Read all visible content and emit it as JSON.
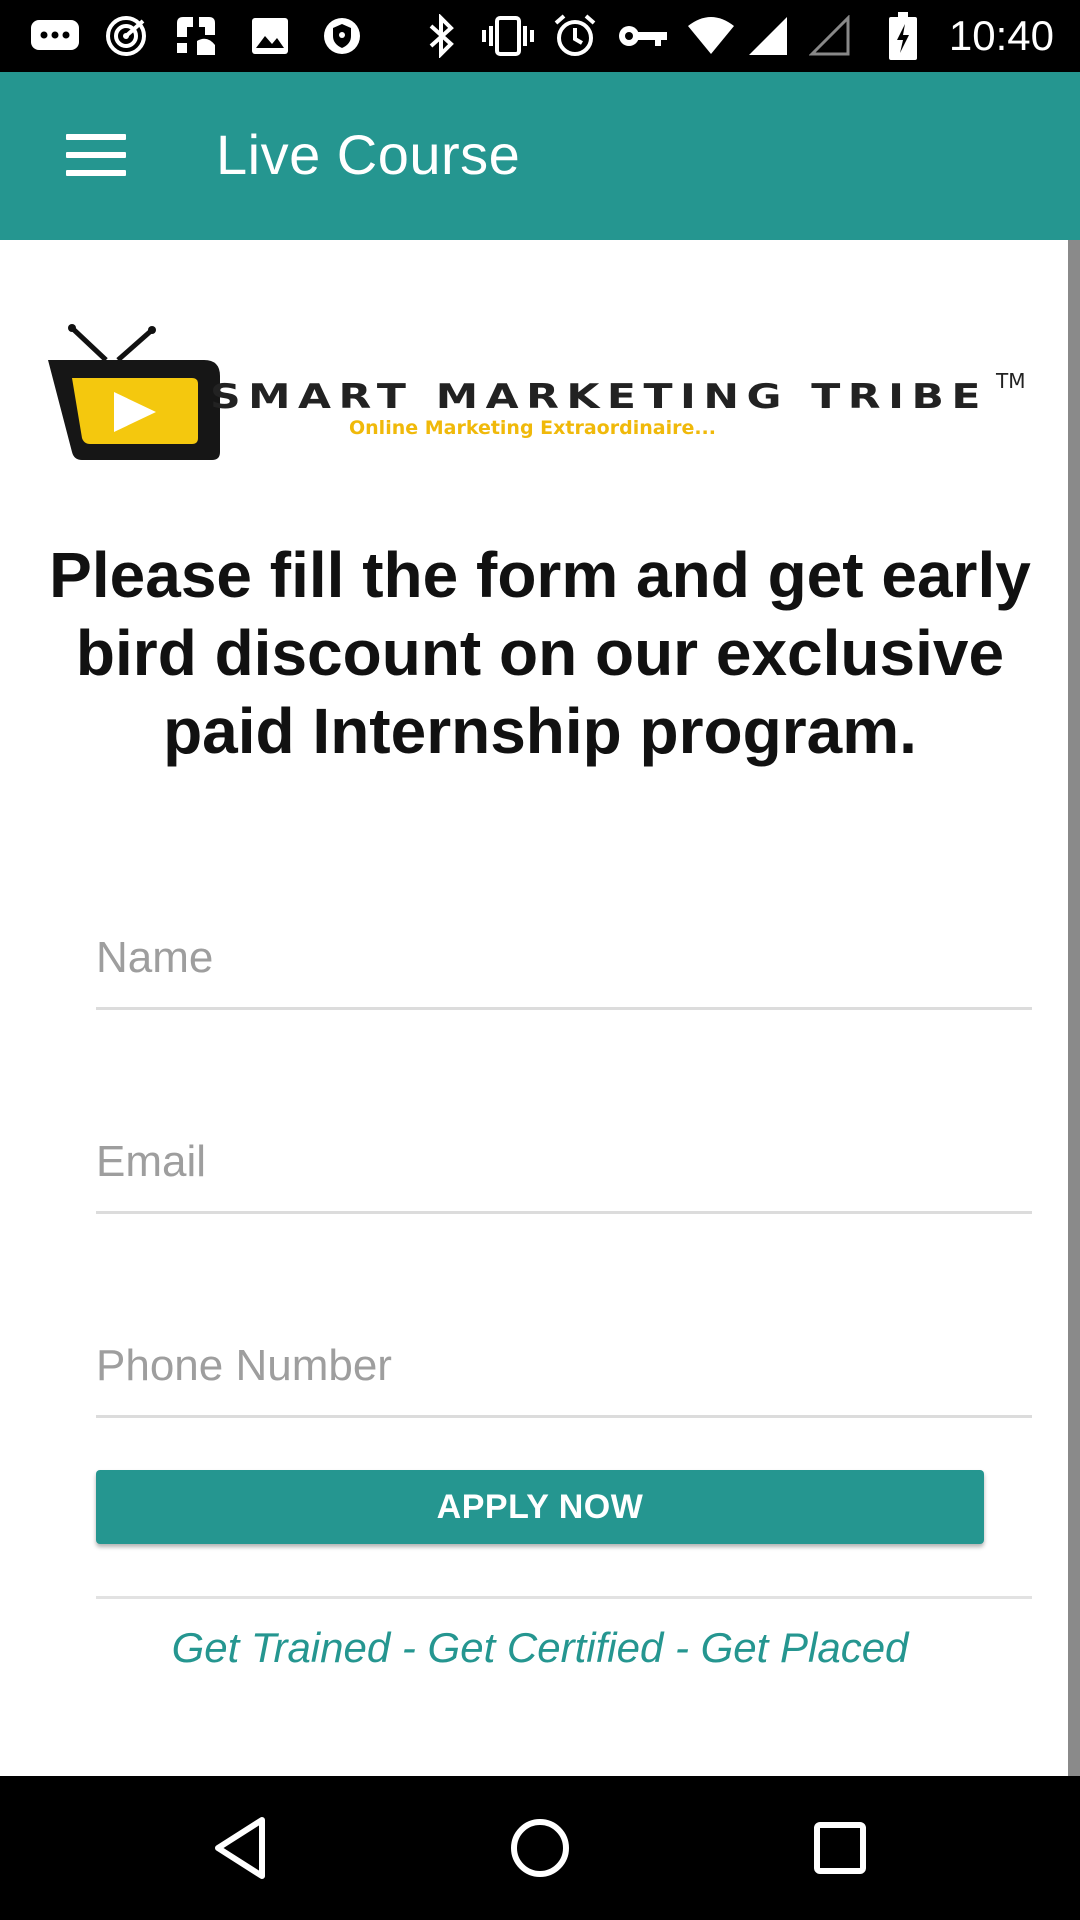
{
  "status_bar": {
    "time": "10:40",
    "icons": [
      "message-icon",
      "radar-icon",
      "app-icon",
      "image-icon",
      "shield-icon",
      "bluetooth-icon",
      "vibrate-icon",
      "alarm-icon",
      "vpn-key-icon",
      "wifi-icon",
      "signal-icon",
      "signal-empty-icon",
      "battery-charging-icon"
    ]
  },
  "app_bar": {
    "title": "Live Course",
    "background": "#259690"
  },
  "logo": {
    "brand": "SMART MARKETING TRIBE",
    "trademark": "TM",
    "slogan": "Online Marketing Extraordinaire..."
  },
  "headline": "Please fill the form and get early bird discount on our exclusive paid Internship program.",
  "form": {
    "name_placeholder": "Name",
    "email_placeholder": "Email",
    "phone_placeholder": "Phone Number",
    "apply_label": "APPLY NOW"
  },
  "tagline": "Get Trained - Get Certified - Get Placed",
  "nav_bar": {
    "icons": [
      "back-icon",
      "home-icon",
      "recents-icon"
    ]
  }
}
